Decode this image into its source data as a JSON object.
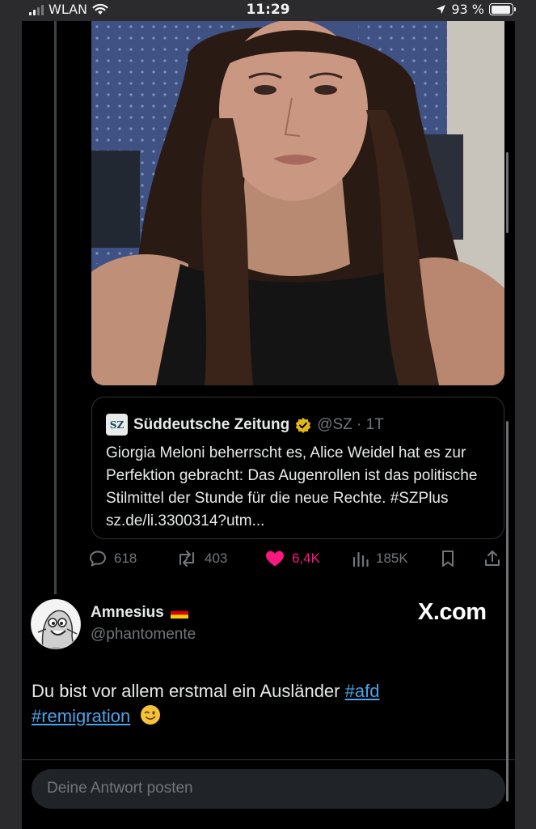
{
  "status_bar": {
    "carrier": "WLAN",
    "time": "11:29",
    "battery": "93 %",
    "battery_level": 0.93
  },
  "quoted_tweet": {
    "source_logo": "SZ",
    "author": "Süddeutsche Zeitung",
    "handle_time": "@SZ · 1T",
    "text": "Giorgia Meloni beherrscht es, Alice Weidel hat es zur Perfektion gebracht: Das Augenrollen ist das politische Stilmittel der Stunde für die neue Rechte. #SZPlus sz.de/li.3300314?utm..."
  },
  "actions": {
    "replies": "618",
    "reposts": "403",
    "likes": "6,4K",
    "views": "185K"
  },
  "reply_tweet": {
    "author": "Amnesius",
    "handle": "@phantomente",
    "brand": "X.com",
    "text_line1": "Du bist vor allem erstmal ein Ausländer ",
    "hashtag1": "#afd",
    "hashtag2": "#remigration"
  },
  "composer": {
    "placeholder": "Deine Antwort posten"
  },
  "colors": {
    "background": "#000000",
    "like_pink": "#f91880",
    "link_blue": "#4aa3e8",
    "muted": "#71767b"
  }
}
